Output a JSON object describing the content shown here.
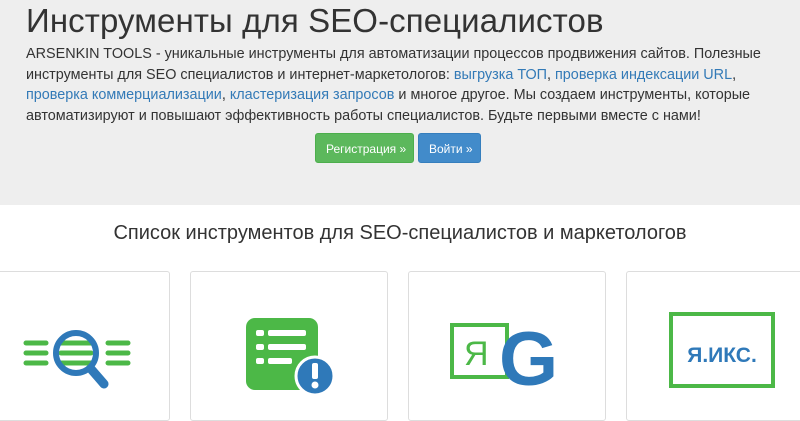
{
  "hero": {
    "title": "Инструменты для SEO-специалистов",
    "text_intro": "ARSENKIN TOOLS - уникальные инструменты для автоматизации процессов продвижения сайтов. Полезные инструменты для SEO специалистов и интернет-маркетологов: ",
    "links": [
      "выгрузка ТОП",
      "проверка индексации URL",
      "проверка коммерциализации",
      "кластеризация запросов"
    ],
    "sep": ", ",
    "text_outro": " и многое другое. Мы создаем инструменты, которые автоматизируют и повышают эффективность работы специалистов. Будьте первыми вместе с нами!",
    "register_label": "Регистрация »",
    "login_label": "Войти »"
  },
  "tools_section": {
    "title": "Список инструментов для SEO-специалистов и маркетологов",
    "cards": [
      {
        "icon": "magnifier-list-icon"
      },
      {
        "icon": "checklist-alert-icon"
      },
      {
        "icon": "yandex-google-icon",
        "icon_text": "Я"
      },
      {
        "icon": "yandex-iks-icon",
        "icon_text": "Я.ИКС."
      }
    ]
  },
  "colors": {
    "green": "#4cb847",
    "blue": "#2f79b9",
    "link": "#337ab7",
    "register_bg": "#5cb85c",
    "login_bg": "#428bca",
    "hero_bg": "#eeeeee"
  }
}
